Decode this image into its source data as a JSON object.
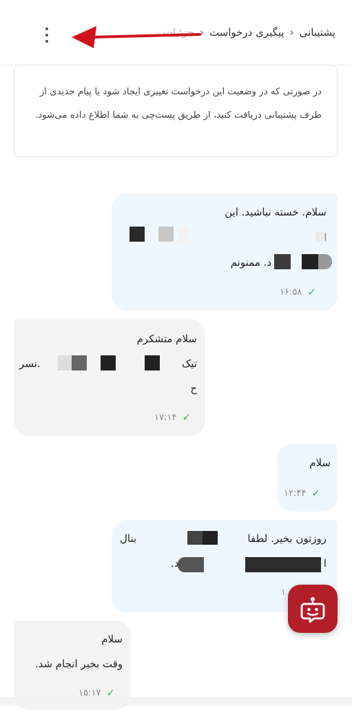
{
  "header": {
    "breadcrumb_support": "پشتیبانی",
    "breadcrumb_tracking": "پیگیری درخواست",
    "breadcrumb_current": "جزئیات"
  },
  "notice": {
    "text": "در صورتی که در وضعیت این درخواست تغییری ایجاد شود یا پیام جدیدی از طرف پشتیبانی دریافت کنید، از طریق پست‌چی به شما اطلاع داده می‌شود."
  },
  "messages": [
    {
      "sender": "me",
      "line1": "سلام. خسته نباشید. این",
      "line2": "ا",
      "line3": "د. ممنونم",
      "time": "۱۶:۵۸"
    },
    {
      "sender": "support",
      "line1": "سلام متشکرم",
      "line2": "تیک",
      "line2_end": ".نسر",
      "line3": "ح",
      "time": "۱۷:۱۴"
    },
    {
      "sender": "me",
      "line1": "سلام",
      "time": "۱۲:۴۴"
    },
    {
      "sender": "me",
      "line1": "روزتون بخیر. لطفا",
      "line1_end": "بنال",
      "line2": "ا",
      "line2_mid": "د.",
      "time": "۱"
    },
    {
      "sender": "support",
      "line1": "سلام",
      "line2": "وقت بخیر انجام شد.",
      "time": "۱۵:۱۷"
    }
  ],
  "colors": {
    "my_bubble": "#eef7fd",
    "support_bubble": "#f3f3f3",
    "fab": "#b31f29",
    "annotation_arrow": "#d0121b",
    "check": "#4caf50"
  },
  "icons": {
    "more": "more-vertical-icon",
    "fab": "support-bot-icon",
    "check": "check-icon"
  }
}
